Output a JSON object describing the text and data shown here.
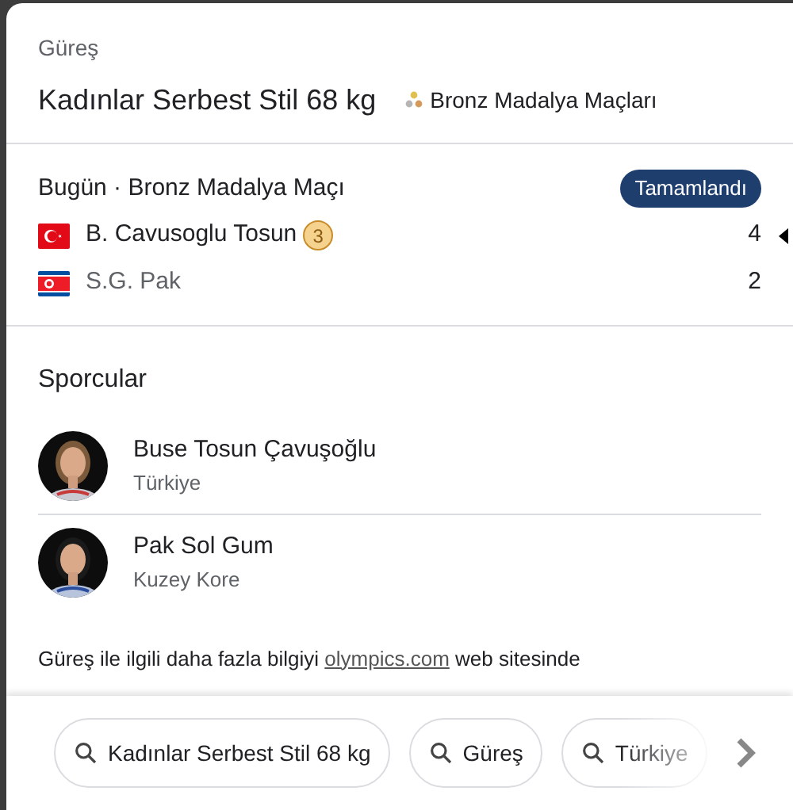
{
  "sport": "Güreş",
  "event": {
    "title": "Kadınlar Serbest Stil 68 kg",
    "phase": "Bronz Madalya Maçları"
  },
  "match": {
    "title": "Bugün · Bronz Madalya Maçı",
    "status": "Tamamlandı",
    "competitors": [
      {
        "kind": "turkey",
        "name": "B. Cavusoglu Tosun",
        "rank": "3",
        "score": "4",
        "winner": true
      },
      {
        "kind": "northkorea",
        "name": "S.G. Pak",
        "score": "2",
        "winner": false
      }
    ]
  },
  "athletes": {
    "title": "Sporcular",
    "items": [
      {
        "name": "Buse Tosun Çavuşoğlu",
        "country": "Türkiye",
        "kind": "picture"
      },
      {
        "name": "Pak Sol Gum",
        "country": "Kuzey Kore",
        "kind": "picture"
      }
    ]
  },
  "footer": {
    "before": "Güreş ile ilgili daha fazla bilgiyi",
    "link": "olympics.com",
    "after": "web sitesinde"
  },
  "chips": [
    "Kadınlar Serbest Stil 68 kg",
    "Güreş",
    "Türkiye"
  ]
}
